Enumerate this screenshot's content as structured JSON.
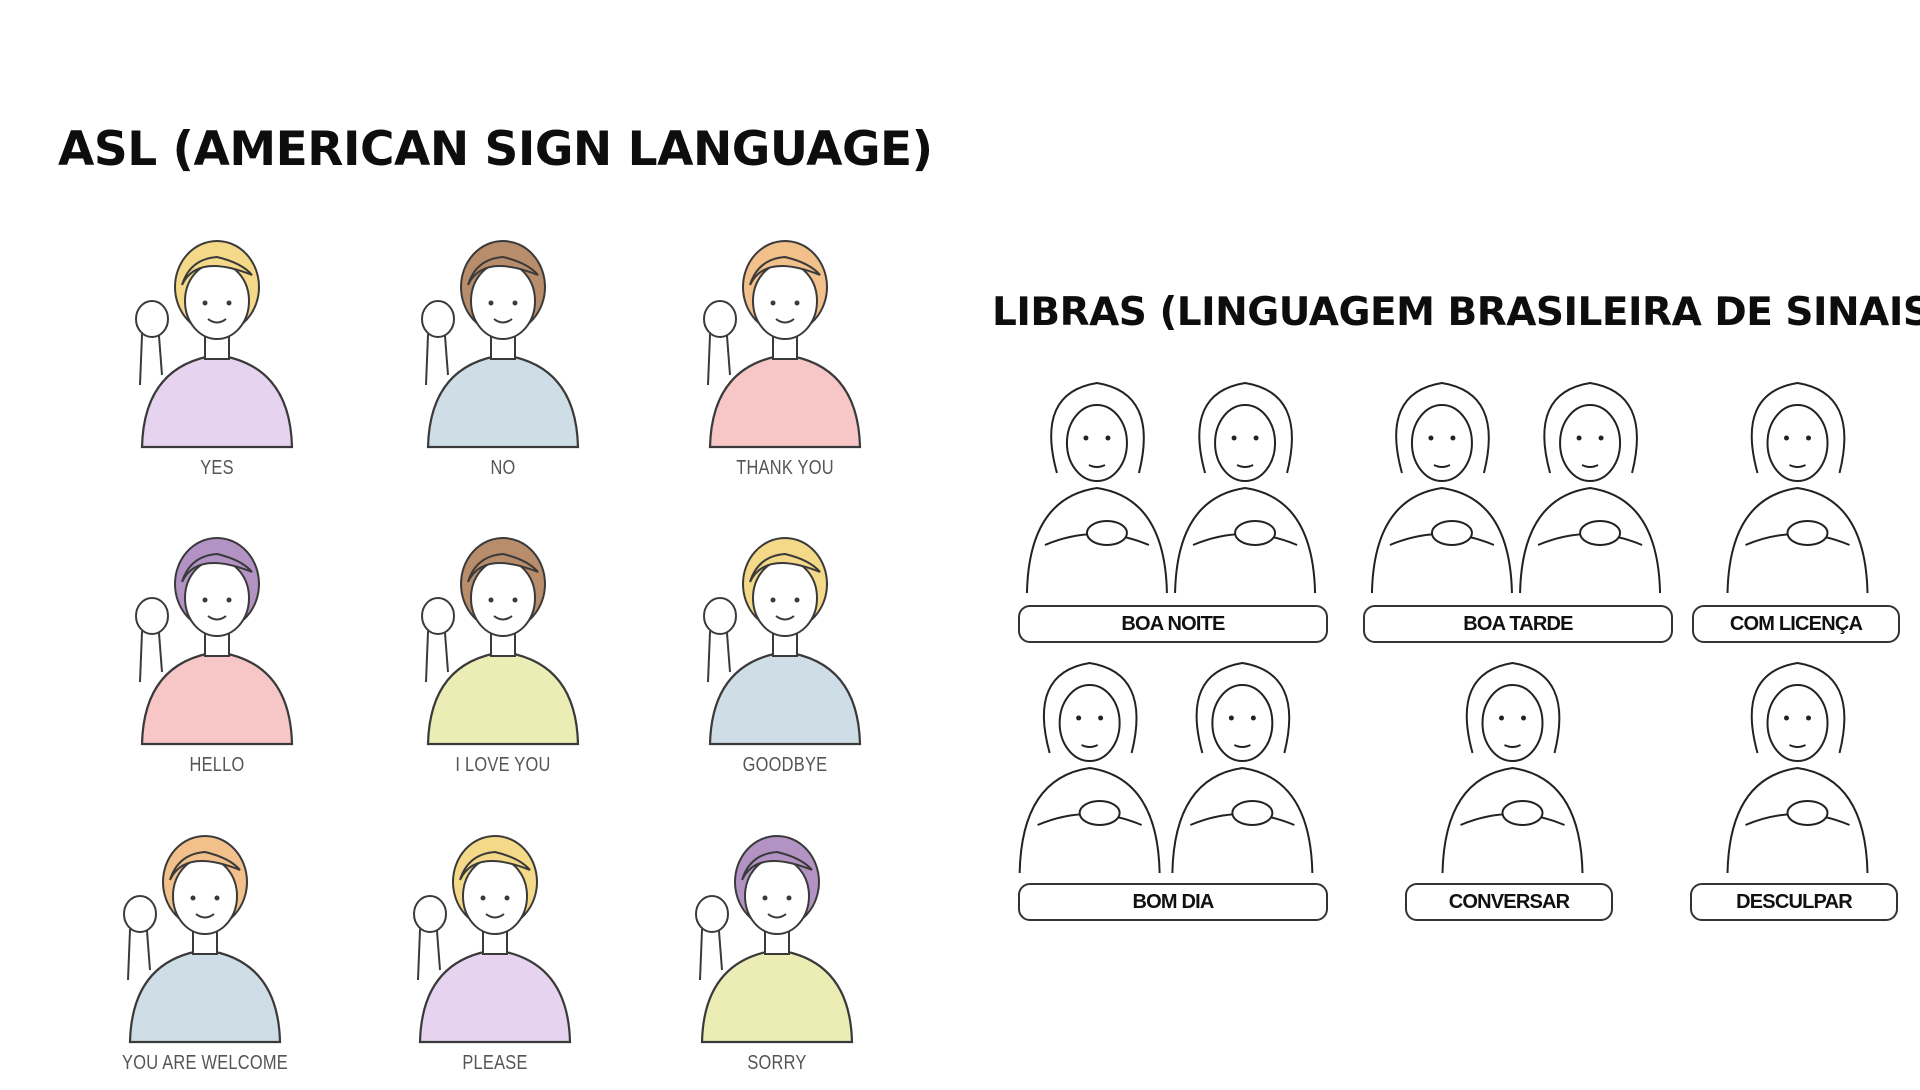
{
  "asl": {
    "title": "ASL  (AMERICAN SIGN LANGUAGE)",
    "signs": [
      {
        "label": "YES",
        "shirt": "#e6d3ef",
        "hair": "#f4d989"
      },
      {
        "label": "NO",
        "shirt": "#cfdee6",
        "hair": "#b88d6b"
      },
      {
        "label": "THANK YOU",
        "shirt": "#f7c6c7",
        "hair": "#f2c08a"
      },
      {
        "label": "HELLO",
        "shirt": "#f7c6c7",
        "hair": "#b393c4"
      },
      {
        "label": "I LOVE YOU",
        "shirt": "#ecedb4",
        "hair": "#b88d6b"
      },
      {
        "label": "GOODBYE",
        "shirt": "#cfdee6",
        "hair": "#f4d989"
      },
      {
        "label": "YOU ARE WELCOME",
        "shirt": "#cfdee6",
        "hair": "#f2c08a"
      },
      {
        "label": "PLEASE",
        "shirt": "#e6d3ef",
        "hair": "#f4d989"
      },
      {
        "label": "SORRY",
        "shirt": "#ecedb4",
        "hair": "#b393c4"
      }
    ]
  },
  "libras": {
    "title": "LIBRAS (LINGUAGEM BRASILEIRA DE SINAIS)",
    "signs": [
      {
        "label": "BOA NOITE"
      },
      {
        "label": "BOA TARDE"
      },
      {
        "label": "COM LICENÇA"
      },
      {
        "label": "BOM DIA"
      },
      {
        "label": "CONVERSAR"
      },
      {
        "label": "DESCULPAR"
      }
    ]
  }
}
